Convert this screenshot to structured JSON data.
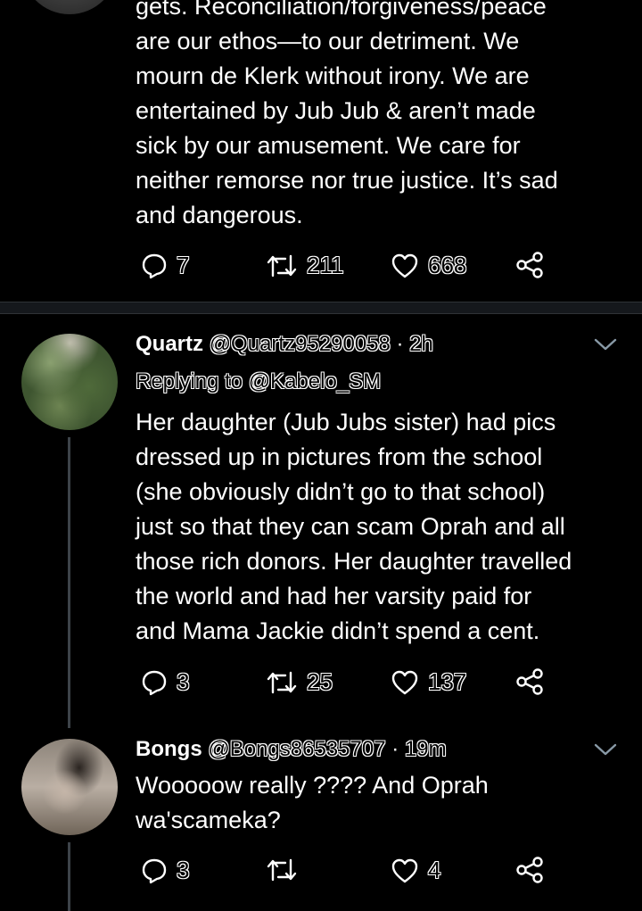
{
  "tweet1": {
    "text_lines": [
      "gets. Reconciliation/forgiveness/peace",
      "are our ethos—to our detriment. We",
      "mourn de Klerk without irony. We are",
      "entertained by Jub Jub & aren’t made",
      "sick by our amusement. We care for",
      "neither remorse nor true justice. It’s sad",
      "and dangerous."
    ],
    "replies": "7",
    "retweets": "211",
    "likes": "668"
  },
  "tweet2": {
    "name": "Quartz",
    "handle": "@Quartz95290058",
    "dot": "·",
    "time": "2h",
    "replying": "Replying to @Kabelo_SM",
    "text_lines": [
      "Her daughter (Jub Jubs sister) had pics",
      "dressed up in pictures from the school",
      "(she obviously didn’t go to that school)",
      "just so that they can scam Oprah and all",
      "those rich donors. Her daughter travelled",
      "the world and had her varsity paid for",
      "and Mama Jackie didn’t spend a cent."
    ],
    "replies": "3",
    "retweets": "25",
    "likes": "137"
  },
  "tweet3": {
    "name": "Bongs",
    "handle": "@Bongs86535707",
    "dot": "·",
    "time": "19m",
    "text_lines": [
      "Wooooow really ???? And Oprah",
      "wa'scameka?"
    ],
    "replies": "3",
    "likes": "4"
  },
  "icons": {
    "reply": "reply-icon",
    "retweet": "retweet-icon",
    "like": "heart-icon",
    "share": "share-icon",
    "more": "chevron-down-icon"
  },
  "colors": {
    "background": "#000000",
    "text": "#ffffff",
    "divider": "#15181c",
    "icon": "#ffffff"
  }
}
